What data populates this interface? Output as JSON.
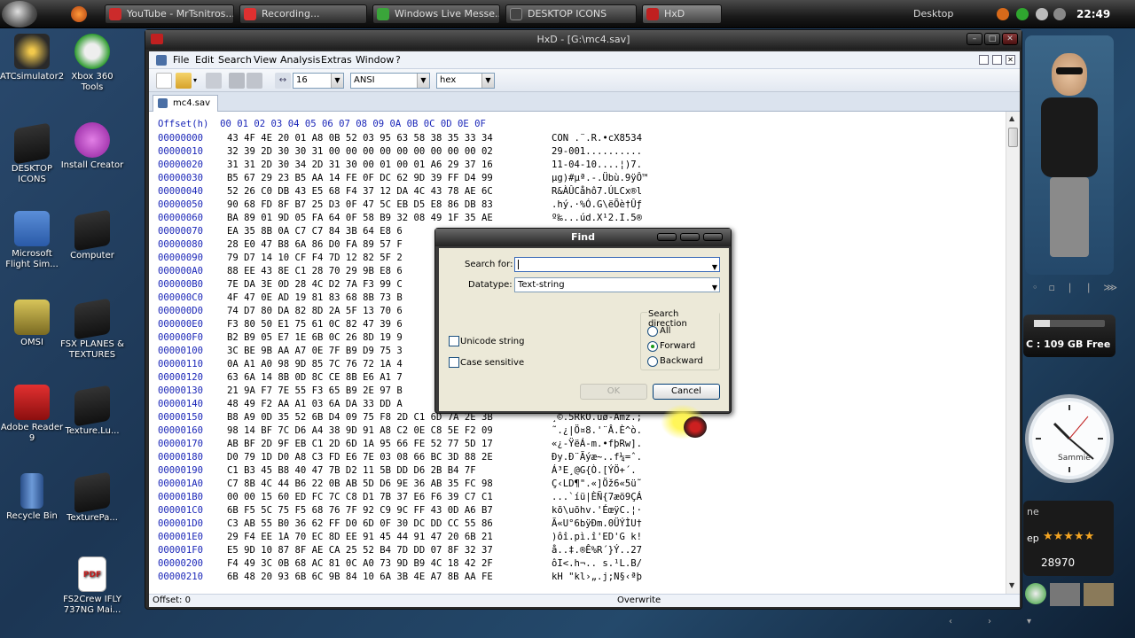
{
  "taskbar": {
    "buttons": [
      {
        "label": "YouTube - MrTsnitros...",
        "color": "#cc2b2b"
      },
      {
        "label": "Recording...",
        "color": "#e03030"
      },
      {
        "label": "Windows Live Messe...",
        "color": "#3aa53a"
      },
      {
        "label": "DESKTOP ICONS",
        "color": "#444"
      },
      {
        "label": "HxD",
        "color": "#c02020"
      }
    ],
    "desktop_label": "Desktop",
    "clock": "22:49"
  },
  "desktop_icons": [
    {
      "label": "ATCsimulator2",
      "color": "#c89d2a"
    },
    {
      "label": "Xbox 360 Tools",
      "color": "#2f9c2f"
    },
    {
      "label": "DESKTOP ICONS",
      "color": "#222"
    },
    {
      "label": "Install Creator",
      "color": "#b235b8"
    },
    {
      "label": "Microsoft Flight Sim...",
      "color": "#3c6fbf"
    },
    {
      "label": "Computer",
      "color": "#222"
    },
    {
      "label": "OMSI",
      "color": "#c8b44a"
    },
    {
      "label": "FSX PLANES & TEXTURES",
      "color": "#222"
    },
    {
      "label": "Adobe Reader 9",
      "color": "#c21a1a"
    },
    {
      "label": "Texture.Lu...",
      "color": "#222"
    },
    {
      "label": "Recycle Bin",
      "color": "#3360a0"
    },
    {
      "label": "TexturePa...",
      "color": "#222"
    },
    {
      "label": "FS2Crew IFLY 737NG Mai...",
      "color": "#ffffff"
    }
  ],
  "hxd": {
    "title": "HxD - [G:\\mc4.sav]",
    "menu": [
      "File",
      "Edit",
      "Search",
      "View",
      "Analysis",
      "Extras",
      "Window",
      "?"
    ],
    "bytes_per_row": "16",
    "charset": "ANSI",
    "offset_base": "hex",
    "tab": "mc4.sav",
    "header": "Offset(h)  00 01 02 03 04 05 06 07 08 09 0A 0B 0C 0D 0E 0F",
    "rows": [
      {
        "o": "00000000",
        "h": "43 4F 4E 20 01 A8 0B 52 03 95 63 58 38 35 33 34",
        "a": "CON .¨.R.•cX8534"
      },
      {
        "o": "00000010",
        "h": "32 39 2D 30 30 31 00 00 00 00 00 00 00 00 00 02",
        "a": "29-001.........."
      },
      {
        "o": "00000020",
        "h": "31 31 2D 30 34 2D 31 30 00 01 00 01 A6 29 37 16",
        "a": "11-04-10....¦)7."
      },
      {
        "o": "00000030",
        "h": "B5 67 29 23 B5 AA 14 FE 0F DC 62 9D 39 FF D4 99",
        "a": "µg)#µª.-.Übù.9ÿÔ™"
      },
      {
        "o": "00000040",
        "h": "52 26 C0 DB 43 E5 68 F4 37 12 DA 4C 43 78 AE 6C",
        "a": "R&ÀÛCåhô7.ÚLCx®l"
      },
      {
        "o": "00000050",
        "h": "90 68 FD 8F B7 25 D3 0F 47 5C EB D5 E8 86 DB 83",
        "a": ".hý.·%Ó.G\\ëÕè†Ûƒ"
      },
      {
        "o": "00000060",
        "h": "BA 89 01 9D 05 FA 64 0F 58 B9 32 08 49 1F 35 AE",
        "a": "º‰...úd.X¹2.I.5®"
      },
      {
        "o": "00000070",
        "h": "EA 35 8B 0A C7 C7 84 3B 64 E8 6",
        "a": ""
      },
      {
        "o": "00000080",
        "h": "28 E0 47 B8 6A 86 D0 FA 89 57 F",
        "a": ""
      },
      {
        "o": "00000090",
        "h": "79 D7 14 10 CF F4 7D 12 82 5F 2",
        "a": ""
      },
      {
        "o": "000000A0",
        "h": "88 EE 43 8E C1 28 70 29 9B E8 6",
        "a": ""
      },
      {
        "o": "000000B0",
        "h": "7E DA 3E 0D 28 4C D2 7A F3 99 C",
        "a": ""
      },
      {
        "o": "000000C0",
        "h": "4F 47 0E AD 19 81 83 68 8B 73 B",
        "a": ""
      },
      {
        "o": "000000D0",
        "h": "74 D7 80 DA 82 8D 2A 5F 13 70 6",
        "a": ""
      },
      {
        "o": "000000E0",
        "h": "F3 80 50 E1 75 61 0C 82 47 39 6",
        "a": ""
      },
      {
        "o": "000000F0",
        "h": "B2 B9 05 E7 1E 6B 0C 26 8D 19 9",
        "a": ""
      },
      {
        "o": "00000100",
        "h": "3C BE 9B AA A7 0E 7F B9 D9 75 3",
        "a": ""
      },
      {
        "o": "00000110",
        "h": "0A A1 A0 98 9D 85 7C 76 72 1A 4",
        "a": ""
      },
      {
        "o": "00000120",
        "h": "63 6A 14 8B 0D 8C CE 8B E6 A1 7",
        "a": ""
      },
      {
        "o": "00000130",
        "h": "21 9A F7 7E 55 F3 65 B9 2E 97 B",
        "a": ""
      },
      {
        "o": "00000140",
        "h": "48 49 F2 AA A1 03 6A DA 33 DD A",
        "a": ""
      },
      {
        "o": "00000150",
        "h": "B8 A9 0D 35 52 6B D4 09 75 F8 2D C1 6D 7A 2E 3B",
        "a": "¸©.5RkÔ.uø-Ámz.;"
      },
      {
        "o": "00000160",
        "h": "98 14 BF 7C D6 A4 38 9D 91 A8 C2 0E C8 5E F2 09",
        "a": "˜.¿|Ö¤8.'¨Â.È^ò."
      },
      {
        "o": "00000170",
        "h": "AB BF 2D 9F EB C1 2D 6D 1A 95 66 FE 52 77 5D 17",
        "a": "«¿-ŸëÁ-m.•fþRw]."
      },
      {
        "o": "00000180",
        "h": "D0 79 1D D0 A8 C3 FD E6 7E 03 08 66 BC 3D 88 2E",
        "a": "Ðy.Ð¨Ãýæ~..f¼=ˆ."
      },
      {
        "o": "00000190",
        "h": "C1 B3 45 B8 40 47 7B D2 11 5B DD D6 2B B4 7F",
        "a": "Á³E¸@G{Ò.[ÝÖ+´."
      },
      {
        "o": "000001A0",
        "h": "C7 8B 4C 44 B6 22 0B AB 5D D6 9E 36 AB 35 FC 98",
        "a": "Ç‹LD¶\".«]Öž6«5ü˜"
      },
      {
        "o": "000001B0",
        "h": "00 00 15 60 ED FC 7C C8 D1 7B 37 E6 F6 39 C7 C1",
        "a": "...`íü|ÈÑ{7æö9ÇÁ"
      },
      {
        "o": "000001C0",
        "h": "6B F5 5C 75 F5 68 76 7F 92 C9 9C FF 43 0D A6 B7",
        "a": "kõ\\uõhv.'ÉœÿC.¦·"
      },
      {
        "o": "000001D0",
        "h": "C3 AB 55 B0 36 62 FF D0 6D 0F 30 DC DD CC 55 86",
        "a": "Ã«U°6bÿÐm.0ÜÝÌU†"
      },
      {
        "o": "000001E0",
        "h": "29 F4 EE 1A 70 EC 8D EE 91 45 44 91 47 20 6B 21",
        "a": ")ôî.pì.î'ED'G k!"
      },
      {
        "o": "000001F0",
        "h": "E5 9D 10 87 8F AE CA 25 52 B4 7D DD 07 8F 32 37",
        "a": "å..‡.®Ê%R´}Ý..27"
      },
      {
        "o": "00000200",
        "h": "F4 49 3C 0B 68 AC 81 0C A0 73 9D B9 4C 18 42 2F",
        "a": "ôI<.h¬.. s.¹L.B/"
      },
      {
        "o": "00000210",
        "h": "6B 48 20 93 6B 6C 9B 84 10 6A 3B 4E A7 8B AA FE",
        "a": "kH \"kl›„.j;N§‹ªþ"
      }
    ],
    "status_offset": "Offset: 0",
    "status_mode": "Overwrite"
  },
  "find_dialog": {
    "title": "Find",
    "search_label": "Search for:",
    "search_value": "",
    "datatype_label": "Datatype:",
    "datatype_value": "Text-string",
    "unicode_label": "Unicode string",
    "case_label": "Case sensitive",
    "direction_label": "Search direction",
    "dir_all": "All",
    "dir_forward": "Forward",
    "dir_backward": "Backward",
    "selected_direction": "Forward",
    "ok": "OK",
    "cancel": "Cancel"
  },
  "gadgets": {
    "drive": "C : 109 GB Free",
    "clock_name": "Sammie",
    "rss_label": "ne",
    "rss_sub": "ep",
    "stars": "★★★★★",
    "count": "28970"
  }
}
